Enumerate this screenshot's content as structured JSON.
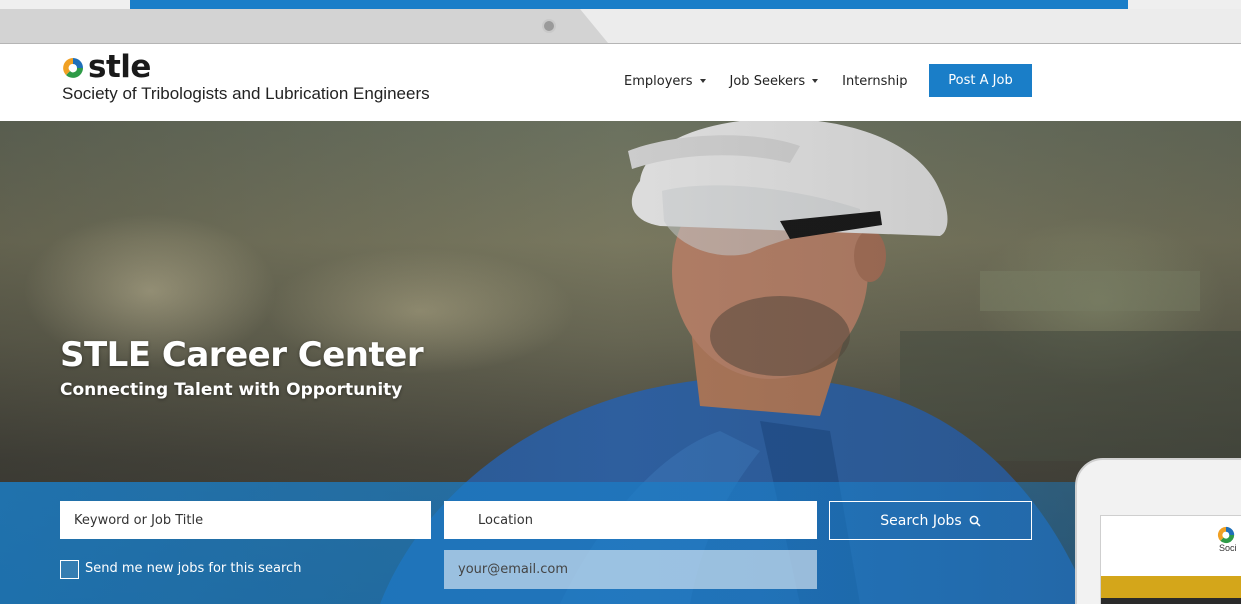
{
  "header": {
    "logo_word": "stle",
    "logo_subtitle": "Society of Tribologists and Lubrication Engineers",
    "nav": [
      {
        "label": "Employers",
        "dropdown": true
      },
      {
        "label": "Job Seekers",
        "dropdown": true
      },
      {
        "label": "Internship",
        "dropdown": false
      }
    ],
    "post_job_label": "Post A Job"
  },
  "hero": {
    "title": "STLE Career Center",
    "subtitle": "Connecting Talent with Opportunity"
  },
  "search": {
    "keyword_placeholder": "Keyword or Job Title",
    "location_placeholder": "Location",
    "search_button_label": "Search Jobs",
    "alert_label": "Send me new jobs for this search",
    "email_placeholder": "your@email.com"
  },
  "device_preview": {
    "text": "Soci"
  },
  "colors": {
    "brand_blue": "#1a7ec8",
    "logo_green": "#2e9b47",
    "logo_blue": "#1f6fb8",
    "logo_orange": "#f0a023"
  },
  "icons": [
    "logo-mark-icon",
    "caret-down-icon",
    "search-icon"
  ]
}
